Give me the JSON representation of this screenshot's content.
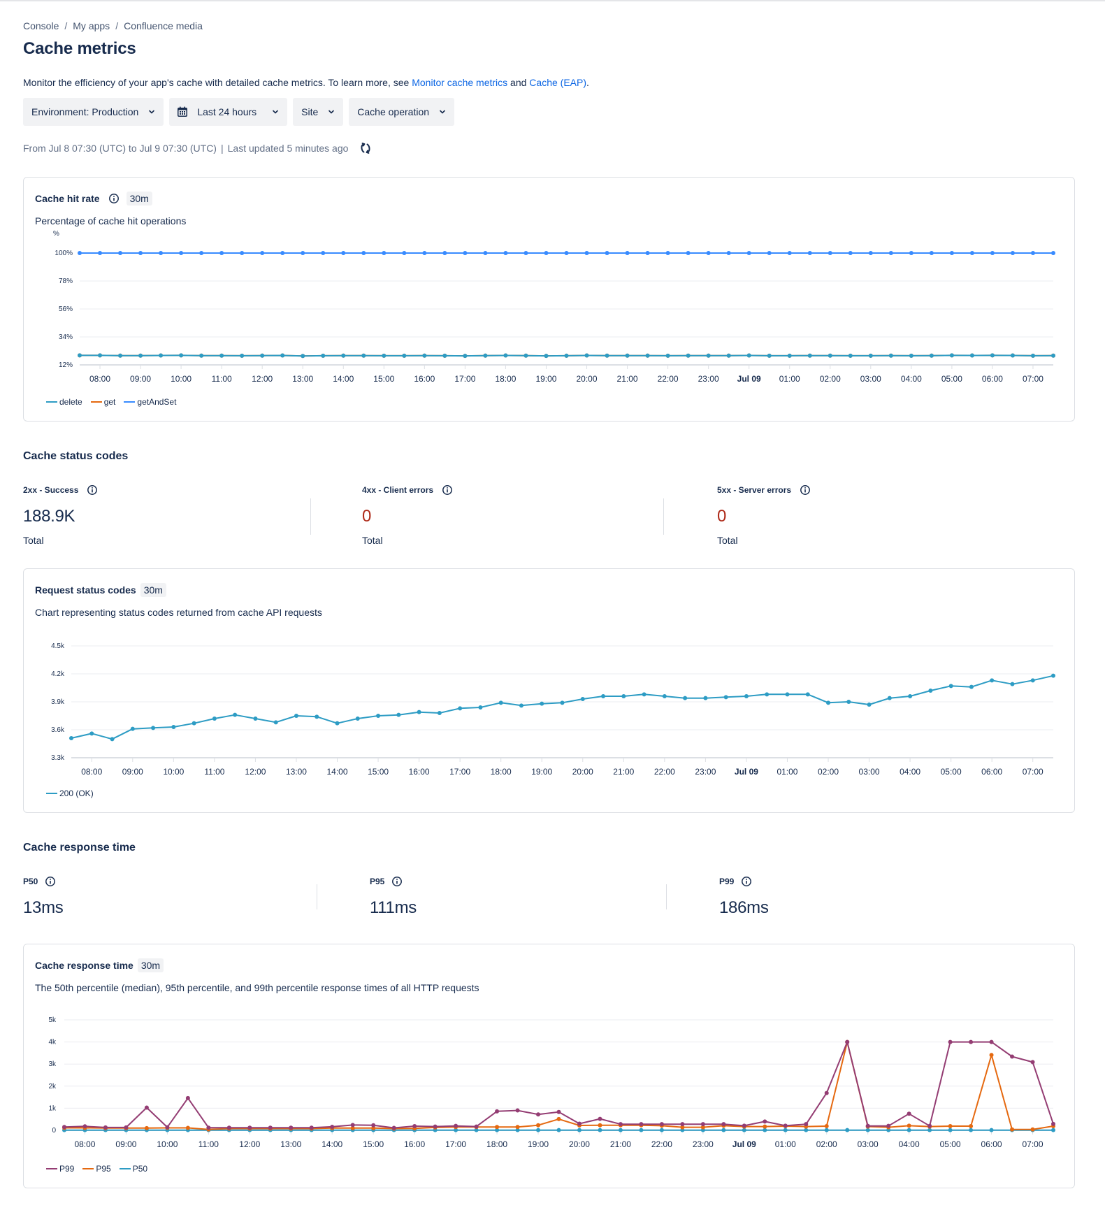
{
  "breadcrumb": [
    "Console",
    "My apps",
    "Confluence media"
  ],
  "breadcrumb_separator": "/",
  "page_title": "Cache metrics",
  "intro": {
    "text": "Monitor the efficiency of your app's cache with detailed cache metrics. To learn more, see ",
    "link1": "Monitor cache metrics",
    "and": " and ",
    "link2": "Cache (EAP)",
    "end": "."
  },
  "filters": {
    "environment": "Environment: Production",
    "timerange": "Last 24 hours",
    "site": "Site",
    "operation": "Cache operation"
  },
  "meta": {
    "range": "From Jul 8 07:30 (UTC) to Jul 9 07:30 (UTC)",
    "separator": "|",
    "updated": "Last updated 5 minutes ago"
  },
  "icons": {
    "calendar": "calendar-icon",
    "chevron": "chevron-down-icon",
    "refresh": "refresh-icon",
    "info": "info-icon"
  },
  "colors": {
    "link": "#0c66e4",
    "error_value": "#ae2a19",
    "delete": "#2d9cc4",
    "get": "#e56910",
    "getAndSet": "#388bff",
    "status200": "#2d9cc4",
    "p99": "#943d73",
    "p95": "#e56910",
    "p50": "#2d9cc4"
  },
  "hit_rate_card": {
    "title": "Cache hit rate",
    "interval": "30m",
    "subtitle": "Percentage of cache hit operations"
  },
  "status_section": {
    "title": "Cache status codes",
    "stats": [
      {
        "label": "2xx - Success",
        "value": "188.9K",
        "sub": "Total"
      },
      {
        "label": "4xx - Client errors",
        "value": "0",
        "sub": "Total"
      },
      {
        "label": "5xx - Server errors",
        "value": "0",
        "sub": "Total"
      }
    ]
  },
  "request_card": {
    "title": "Request status codes",
    "interval": "30m",
    "subtitle": "Chart representing status codes returned from cache API requests"
  },
  "response_section": {
    "title": "Cache response time",
    "stats": [
      {
        "label": "P50",
        "value": "13ms"
      },
      {
        "label": "P95",
        "value": "111ms"
      },
      {
        "label": "P99",
        "value": "186ms"
      }
    ]
  },
  "response_card": {
    "title": "Cache response time",
    "interval": "30m",
    "subtitle": "The 50th percentile (median), 95th percentile, and 99th percentile response times of all HTTP requests"
  },
  "chart_data": [
    {
      "type": "line",
      "title": "Cache hit rate",
      "ylabel": "%",
      "ylim": [
        12,
        100
      ],
      "yticks": [
        "12%",
        "34%",
        "56%",
        "78%",
        "100%"
      ],
      "ytick_values": [
        12,
        34,
        56,
        78,
        100
      ],
      "xlabels": [
        "08:00",
        "09:00",
        "10:00",
        "11:00",
        "12:00",
        "13:00",
        "14:00",
        "15:00",
        "16:00",
        "17:00",
        "18:00",
        "19:00",
        "20:00",
        "21:00",
        "22:00",
        "23:00",
        "Jul 09",
        "01:00",
        "02:00",
        "03:00",
        "04:00",
        "05:00",
        "06:00",
        "07:00"
      ],
      "x_start": "Jul 8 07:30",
      "x_step": "30m",
      "grid": true,
      "legend": "bottom-left",
      "series": [
        {
          "name": "delete",
          "color": "#2d9cc4",
          "values": [
            19.5,
            19.5,
            19.3,
            19.3,
            19.4,
            19.5,
            19.3,
            19.3,
            19.2,
            19.3,
            19.4,
            19.0,
            19.2,
            19.3,
            19.3,
            19.2,
            19.2,
            19.3,
            19.2,
            19.1,
            19.3,
            19.4,
            19.3,
            19.1,
            19.2,
            19.4,
            19.3,
            19.3,
            19.3,
            19.2,
            19.3,
            19.3,
            19.3,
            19.4,
            19.2,
            19.2,
            19.3,
            19.3,
            19.2,
            19.2,
            19.3,
            19.2,
            19.3,
            19.5,
            19.4,
            19.5,
            19.4,
            19.2,
            19.3
          ]
        },
        {
          "name": "get",
          "color": "#e56910",
          "values": [
            19.5,
            19.5,
            19.3,
            19.3,
            19.4,
            19.5,
            19.3,
            19.3,
            19.2,
            19.3,
            19.4,
            19.0,
            19.2,
            19.3,
            19.3,
            19.2,
            19.2,
            19.3,
            19.2,
            19.1,
            19.3,
            19.4,
            19.3,
            19.1,
            19.2,
            19.4,
            19.3,
            19.3,
            19.3,
            19.2,
            19.3,
            19.3,
            19.3,
            19.4,
            19.2,
            19.2,
            19.3,
            19.3,
            19.2,
            19.2,
            19.3,
            19.2,
            19.3,
            19.5,
            19.4,
            19.5,
            19.4,
            19.2,
            19.3
          ]
        },
        {
          "name": "getAndSet",
          "color": "#388bff",
          "values": [
            100,
            100,
            100,
            100,
            100,
            100,
            100,
            100,
            100,
            100,
            100,
            100,
            100,
            100,
            100,
            100,
            100,
            100,
            100,
            100,
            100,
            100,
            100,
            100,
            100,
            100,
            100,
            100,
            100,
            100,
            100,
            100,
            100,
            100,
            100,
            100,
            100,
            100,
            100,
            100,
            100,
            100,
            100,
            100,
            100,
            100,
            100,
            100,
            100
          ]
        }
      ]
    },
    {
      "type": "line",
      "title": "Request status codes",
      "ylim": [
        3300,
        4500
      ],
      "yticks": [
        "3.3k",
        "3.6k",
        "3.9k",
        "4.2k",
        "4.5k"
      ],
      "ytick_values": [
        3300,
        3600,
        3900,
        4200,
        4500
      ],
      "xlabels": [
        "08:00",
        "09:00",
        "10:00",
        "11:00",
        "12:00",
        "13:00",
        "14:00",
        "15:00",
        "16:00",
        "17:00",
        "18:00",
        "19:00",
        "20:00",
        "21:00",
        "22:00",
        "23:00",
        "Jul 09",
        "01:00",
        "02:00",
        "03:00",
        "04:00",
        "05:00",
        "06:00",
        "07:00"
      ],
      "x_start": "Jul 8 07:30",
      "x_step": "30m",
      "grid": true,
      "legend": "bottom-left",
      "series": [
        {
          "name": "200 (OK)",
          "color": "#2d9cc4",
          "values": [
            3510,
            3560,
            3500,
            3610,
            3620,
            3630,
            3670,
            3720,
            3760,
            3720,
            3680,
            3750,
            3740,
            3670,
            3720,
            3750,
            3760,
            3790,
            3780,
            3830,
            3840,
            3890,
            3860,
            3880,
            3890,
            3930,
            3960,
            3960,
            3980,
            3960,
            3940,
            3940,
            3950,
            3960,
            3980,
            3980,
            3980,
            3890,
            3900,
            3870,
            3940,
            3960,
            4020,
            4070,
            4060,
            4130,
            4090,
            4130,
            4180
          ]
        }
      ]
    },
    {
      "type": "line",
      "title": "Cache response time",
      "ylim": [
        0,
        5000
      ],
      "yticks": [
        "0",
        "1k",
        "2k",
        "3k",
        "4k",
        "5k"
      ],
      "ytick_values": [
        0,
        1000,
        2000,
        3000,
        4000,
        5000
      ],
      "xlabels": [
        "08:00",
        "09:00",
        "10:00",
        "11:00",
        "12:00",
        "13:00",
        "14:00",
        "15:00",
        "16:00",
        "17:00",
        "18:00",
        "19:00",
        "20:00",
        "21:00",
        "22:00",
        "23:00",
        "Jul 09",
        "01:00",
        "02:00",
        "03:00",
        "04:00",
        "05:00",
        "06:00",
        "07:00"
      ],
      "x_start": "Jul 8 07:30",
      "x_step": "30m",
      "grid": true,
      "legend": "bottom-left",
      "series": [
        {
          "name": "P99",
          "color": "#943d73",
          "values": [
            150,
            180,
            130,
            130,
            1030,
            140,
            1460,
            120,
            120,
            120,
            120,
            120,
            120,
            160,
            240,
            230,
            110,
            190,
            170,
            200,
            170,
            860,
            900,
            720,
            830,
            300,
            520,
            280,
            280,
            280,
            280,
            280,
            280,
            210,
            400,
            210,
            280,
            1690,
            4000,
            200,
            200,
            750,
            200,
            4000,
            4000,
            4000,
            3340,
            3090,
            290
          ]
        },
        {
          "name": "P95",
          "color": "#e56910",
          "values": [
            110,
            110,
            100,
            100,
            100,
            110,
            110,
            40,
            80,
            80,
            80,
            80,
            80,
            100,
            100,
            100,
            80,
            90,
            130,
            150,
            150,
            150,
            150,
            230,
            510,
            220,
            230,
            230,
            230,
            210,
            140,
            140,
            210,
            170,
            170,
            190,
            170,
            190,
            4000,
            170,
            140,
            210,
            170,
            190,
            190,
            3410,
            40,
            40,
            190
          ]
        },
        {
          "name": "P50",
          "color": "#2d9cc4",
          "values": [
            10,
            10,
            10,
            10,
            10,
            10,
            10,
            10,
            10,
            10,
            10,
            10,
            10,
            10,
            10,
            10,
            10,
            10,
            10,
            10,
            10,
            10,
            10,
            10,
            10,
            10,
            10,
            10,
            10,
            10,
            10,
            10,
            10,
            10,
            10,
            10,
            10,
            10,
            10,
            10,
            10,
            10,
            10,
            10,
            10,
            10,
            10,
            10,
            10
          ]
        }
      ]
    }
  ]
}
